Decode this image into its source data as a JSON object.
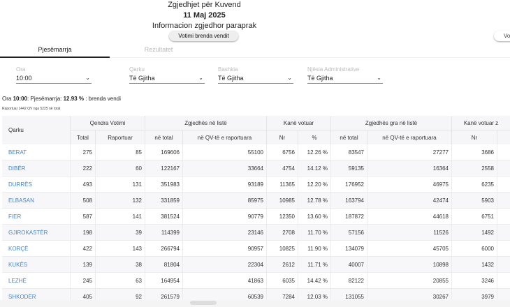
{
  "header": {
    "title": "Zgjedhjet për Kuvend",
    "date": "11 Maj 2025",
    "subtitle": "Informacion zgjedhor paraprak"
  },
  "buttons": {
    "voting_in": "Votimi brenda vendit",
    "voting_out": "Vo"
  },
  "tabs": [
    {
      "label": "Pjesëmarrja"
    },
    {
      "label": "Rezultatet"
    }
  ],
  "filters": [
    {
      "label": "Ora",
      "value": "10:00"
    },
    {
      "label": "Qarku",
      "value": "Të Gjitha"
    },
    {
      "label": "Bashkia",
      "value": "Të Gjitha"
    },
    {
      "label": "Njësia Administrative",
      "value": "Të Gjitha"
    }
  ],
  "summary": {
    "pre": "Ora ",
    "time": "10:00",
    "mid": ": Pjesëmarrja: ",
    "pct": "12.93 %",
    "post": " : brenda vendi"
  },
  "report_line": "Raportuar 1442 QV nga 5225 në total",
  "table": {
    "header": {
      "qarku": "Qarku",
      "g1": "Qendra Votimi",
      "g2": "Zgjedhës në listë",
      "g3": "Kanë votuar",
      "g4": "Zgjedhës gra në listë",
      "g5": "Kanë votuar z",
      "total": "Total",
      "raportuar": "Raportuar",
      "ne_total": "në total",
      "ne_qv": "në QV-të e raportuara",
      "nr": "Nr",
      "pct": "%",
      "ne_total2": "në total",
      "ne_qv2": "në QV-të e raportuara",
      "nr2": "Nr"
    },
    "rows": [
      {
        "name": "BERAT",
        "total": "275",
        "rap": "85",
        "zt": "169606",
        "zq": "55100",
        "nr": "6756",
        "pct": "12.26 %",
        "gt": "83547",
        "gq": "27277",
        "gnr": "3686"
      },
      {
        "name": "DIBËR",
        "total": "222",
        "rap": "60",
        "zt": "122167",
        "zq": "33664",
        "nr": "4754",
        "pct": "14.12 %",
        "gt": "59135",
        "gq": "16364",
        "gnr": "2558"
      },
      {
        "name": "DURRËS",
        "total": "493",
        "rap": "131",
        "zt": "351983",
        "zq": "93189",
        "nr": "11365",
        "pct": "12.20 %",
        "gt": "176952",
        "gq": "46975",
        "gnr": "6235"
      },
      {
        "name": "ELBASAN",
        "total": "508",
        "rap": "132",
        "zt": "331859",
        "zq": "85975",
        "nr": "10985",
        "pct": "12.78 %",
        "gt": "163794",
        "gq": "42474",
        "gnr": "5903"
      },
      {
        "name": "FIER",
        "total": "587",
        "rap": "141",
        "zt": "381524",
        "zq": "90779",
        "nr": "12350",
        "pct": "13.60 %",
        "gt": "187872",
        "gq": "44618",
        "gnr": "6751"
      },
      {
        "name": "GJIROKASTËR",
        "total": "198",
        "rap": "39",
        "zt": "114399",
        "zq": "23146",
        "nr": "2708",
        "pct": "11.70 %",
        "gt": "57156",
        "gq": "11526",
        "gnr": "1492"
      },
      {
        "name": "KORÇË",
        "total": "422",
        "rap": "143",
        "zt": "266794",
        "zq": "90957",
        "nr": "10825",
        "pct": "11.90 %",
        "gt": "134079",
        "gq": "45705",
        "gnr": "6000"
      },
      {
        "name": "KUKËS",
        "total": "139",
        "rap": "38",
        "zt": "81804",
        "zq": "22304",
        "nr": "2612",
        "pct": "11.71 %",
        "gt": "40007",
        "gq": "10898",
        "gnr": "1432"
      },
      {
        "name": "LEZHË",
        "total": "245",
        "rap": "63",
        "zt": "164954",
        "zq": "41863",
        "nr": "6035",
        "pct": "14.42 %",
        "gt": "82122",
        "gq": "20855",
        "gnr": "3246"
      },
      {
        "name": "SHKODËR",
        "total": "405",
        "rap": "92",
        "zt": "261579",
        "zq": "60539",
        "nr": "7284",
        "pct": "12.03 %",
        "gt": "131055",
        "gq": "30267",
        "gnr": "3979"
      }
    ]
  }
}
